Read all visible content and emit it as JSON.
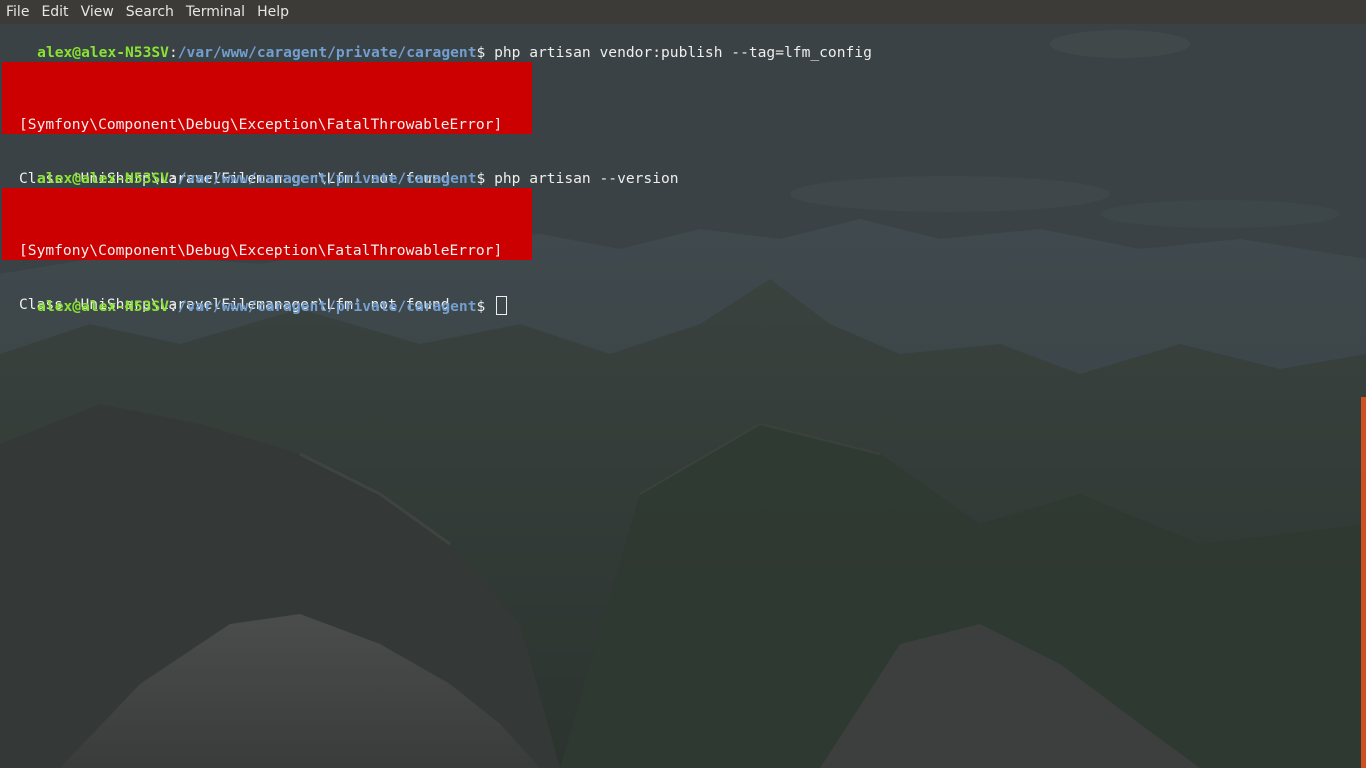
{
  "menu": {
    "items": [
      "File",
      "Edit",
      "View",
      "Search",
      "Terminal",
      "Help"
    ]
  },
  "terminal": {
    "prompt_user": "alex@alex-N53SV",
    "prompt_sep": ":",
    "prompt_path": "/var/www/caragent/private/caragent",
    "prompt_symbol": "$ ",
    "commands": [
      "php artisan vendor:publish --tag=lfm_config",
      "php artisan --version"
    ],
    "error": {
      "line1": "[Symfony\\Component\\Debug\\Exception\\FatalThrowableError]",
      "line2": "Class 'UniSharp\\LaravelFilemanager\\Lfm' not found"
    }
  },
  "colors": {
    "menubar": "#3c3b37",
    "prompt_user": "#8ae234",
    "prompt_path": "#729fcf",
    "error_bg": "#cc0000",
    "scrollbar": "#e95420"
  },
  "icons": {
    "cursor": "block-cursor"
  }
}
